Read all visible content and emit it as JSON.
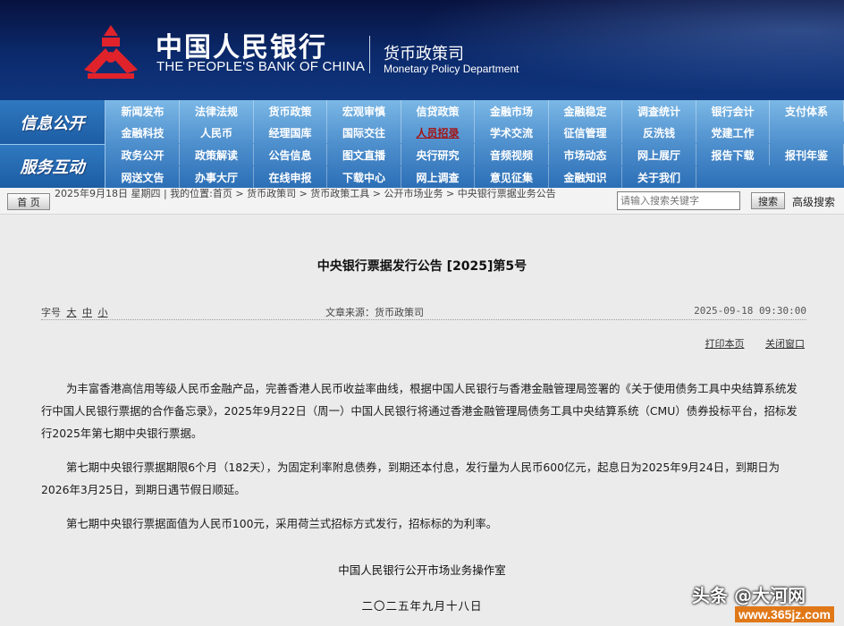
{
  "header": {
    "bank_cn": "中国人民银行",
    "bank_en": "THE PEOPLE'S BANK OF CHINA",
    "dept_cn": "货币政策司",
    "dept_en": "Monetary Policy Department",
    "logo_icon": "pboc-logo-icon",
    "colors": {
      "banner": "#0b2a6c",
      "logo": "#e0232b"
    }
  },
  "nav": {
    "label_1": "信息公开",
    "label_2": "服务互动",
    "rows": [
      [
        "新闻发布",
        "法律法规",
        "货币政策",
        "宏观审慎",
        "信贷政策",
        "金融市场",
        "金融稳定",
        "调查统计",
        "银行会计",
        "支付体系"
      ],
      [
        "金融科技",
        "人民币",
        "经理国库",
        "国际交往",
        "人员招录",
        "学术交流",
        "征信管理",
        "反洗钱",
        "党建工作"
      ],
      [
        "政务公开",
        "政策解读",
        "公告信息",
        "图文直播",
        "央行研究",
        "音频视频",
        "市场动态",
        "网上展厅",
        "报告下载",
        "报刊年鉴"
      ],
      [
        "网送文告",
        "办事大厅",
        "在线申报",
        "下载中心",
        "网上调查",
        "意见征集",
        "金融知识",
        "关于我们"
      ]
    ]
  },
  "breadcrumb": {
    "home_button": "首 页",
    "text": "2025年9月18日 星期四 | 我的位置:首页 > 货币政策司 > 货币政策工具 > 公开市场业务 > 中央银行票据业务公告"
  },
  "search": {
    "placeholder": "请输入搜索关键字",
    "button": "搜索",
    "advanced": "高级搜索"
  },
  "article": {
    "title": "中央银行票据发行公告 [2025]第5号",
    "font_size_label": "字号",
    "font_sizes": [
      "大",
      "中",
      "小"
    ],
    "source": "文章来源：货币政策司",
    "datetime": "2025-09-18 09:30:00",
    "print_link": "打印本页",
    "close_link": "关闭窗口",
    "paragraphs": [
      "为丰富香港高信用等级人民币金融产品，完善香港人民币收益率曲线，根据中国人民银行与香港金融管理局签署的《关于使用债务工具中央结算系统发行中国人民银行票据的合作备忘录》，2025年9月22日（周一）中国人民银行将通过香港金融管理局债务工具中央结算系统（CMU）债券投标平台，招标发行2025年第七期中央银行票据。",
      "第七期中央银行票据期限6个月（182天），为固定利率附息债券，到期还本付息，发行量为人民币600亿元，起息日为2025年9月24日，到期日为2026年3月25日，到期日遇节假日顺延。",
      "第七期中央银行票据面值为人民币100元，采用荷兰式招标方式发行，招标标的为利率。"
    ],
    "signature": "中国人民银行公开市场业务操作室",
    "sign_date": "二〇二五年九月十八日"
  },
  "watermark": {
    "text": "头条 @大河网",
    "url": "www.365jz.com"
  }
}
